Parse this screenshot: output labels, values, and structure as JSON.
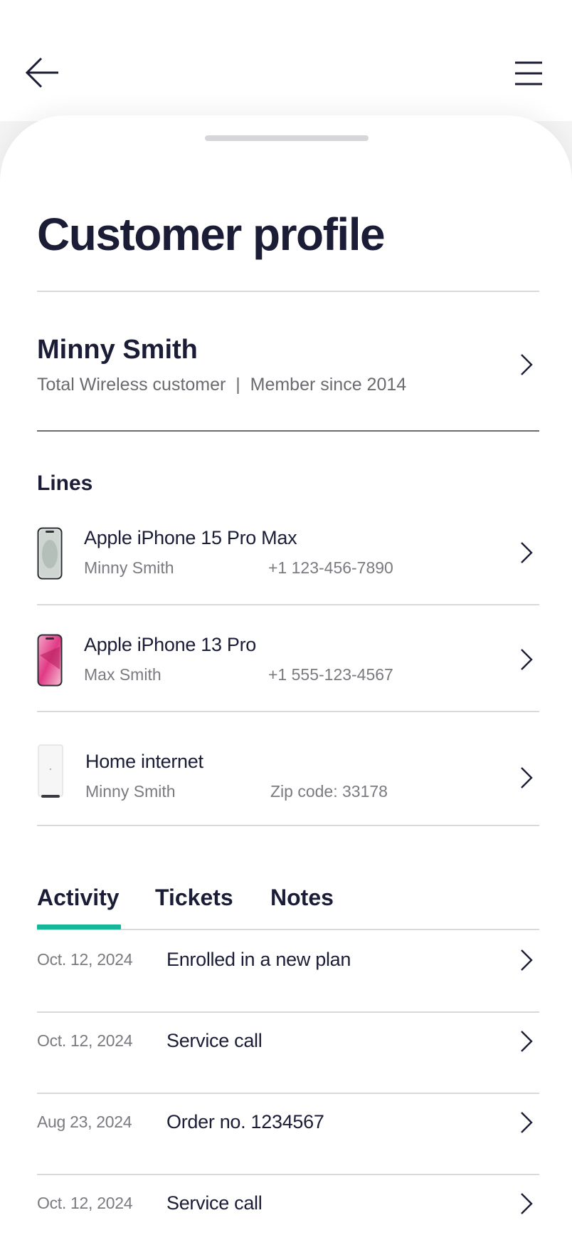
{
  "header": {
    "back_icon": "arrow-left-icon",
    "menu_icon": "hamburger-menu-icon"
  },
  "page": {
    "title": "Customer profile"
  },
  "customer": {
    "name": "Minny Smith",
    "subtitle": "Total Wireless customer  |  Member since 2014"
  },
  "lines": {
    "title": "Lines",
    "items": [
      {
        "device": "Apple iPhone 15 Pro Max",
        "owner": "Minny Smith",
        "detail": "+1 123-456-7890",
        "icon": "iphone-15-pro-max-icon"
      },
      {
        "device": "Apple iPhone 13 Pro",
        "owner": "Max Smith",
        "detail": "+1 555-123-4567",
        "icon": "iphone-13-pro-icon"
      },
      {
        "device": "Home internet",
        "owner": "Minny Smith",
        "detail": "Zip code: 33178",
        "icon": "home-internet-router-icon"
      }
    ]
  },
  "tabs": {
    "items": [
      "Activity",
      "Tickets",
      "Notes"
    ],
    "active": "Activity",
    "accent_color": "#17b59a"
  },
  "activity": [
    {
      "date": "Oct. 12, 2024",
      "text": "Enrolled in a new plan"
    },
    {
      "date": "Oct. 12, 2024",
      "text": "Service call"
    },
    {
      "date": "Aug 23, 2024",
      "text": "Order no. 1234567"
    },
    {
      "date": "Oct. 12, 2024",
      "text": "Service call"
    }
  ]
}
